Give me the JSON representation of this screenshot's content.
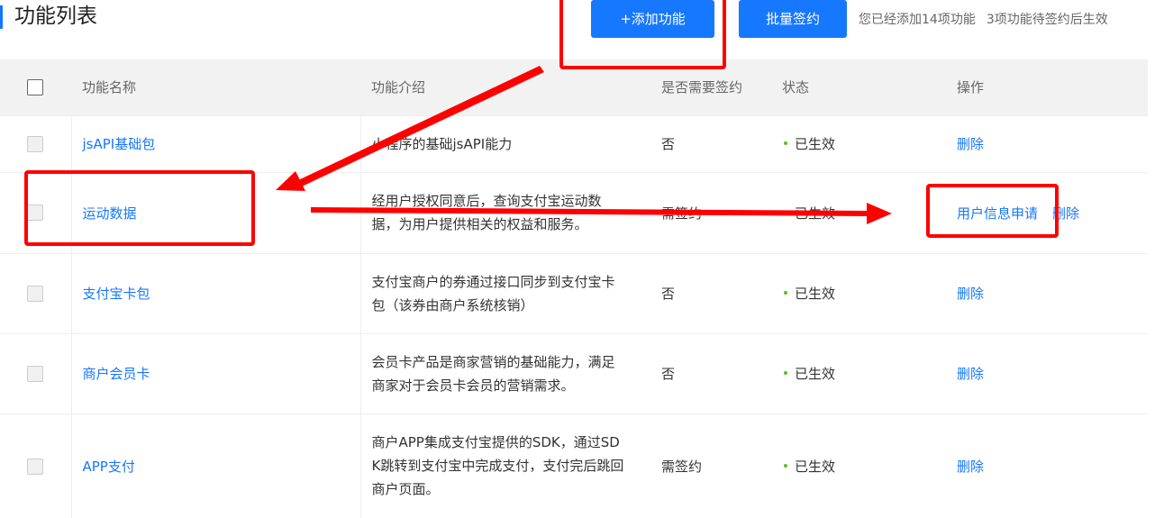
{
  "header": {
    "title": "功能列表",
    "add_button": "+添加功能",
    "batch_sign_button": "批量签约",
    "summary_added": "您已经添加14项功能",
    "summary_pending": "3项功能待签约后生效"
  },
  "table": {
    "columns": [
      "功能名称",
      "功能介绍",
      "是否需要签约",
      "状态",
      "操作"
    ],
    "rows": [
      {
        "name": "jsAPI基础包",
        "desc": [
          "小程序的基础jsAPI能力"
        ],
        "sign": "否",
        "status": "已生效",
        "actions": [
          "删除"
        ]
      },
      {
        "name": "运动数据",
        "desc": [
          "经用户授权同意后，查询支付宝运动数",
          "据，为用户提供相关的权益和服务。"
        ],
        "sign": "需签约",
        "status": "已生效",
        "actions": [
          "用户信息申请",
          "删除"
        ]
      },
      {
        "name": "支付宝卡包",
        "desc": [
          "支付宝商户的券通过接口同步到支付宝卡",
          "包（该券由商户系统核销）"
        ],
        "sign": "否",
        "status": "已生效",
        "actions": [
          "删除"
        ]
      },
      {
        "name": "商户会员卡",
        "desc": [
          "会员卡产品是商家营销的基础能力，满足",
          "商家对于会员卡会员的营销需求。"
        ],
        "sign": "否",
        "status": "已生效",
        "actions": [
          "删除"
        ]
      },
      {
        "name": "APP支付",
        "desc": [
          "商户APP集成支付宝提供的SDK，通过SD",
          "K跳转到支付宝中完成支付，支付完后跳回",
          "商户页面。"
        ],
        "sign": "需签约",
        "status": "已生效",
        "actions": [
          "删除"
        ]
      }
    ]
  },
  "colors": {
    "accent": "#1677ff",
    "status_dot": "#52c41a",
    "annotation": "#ff0000"
  }
}
